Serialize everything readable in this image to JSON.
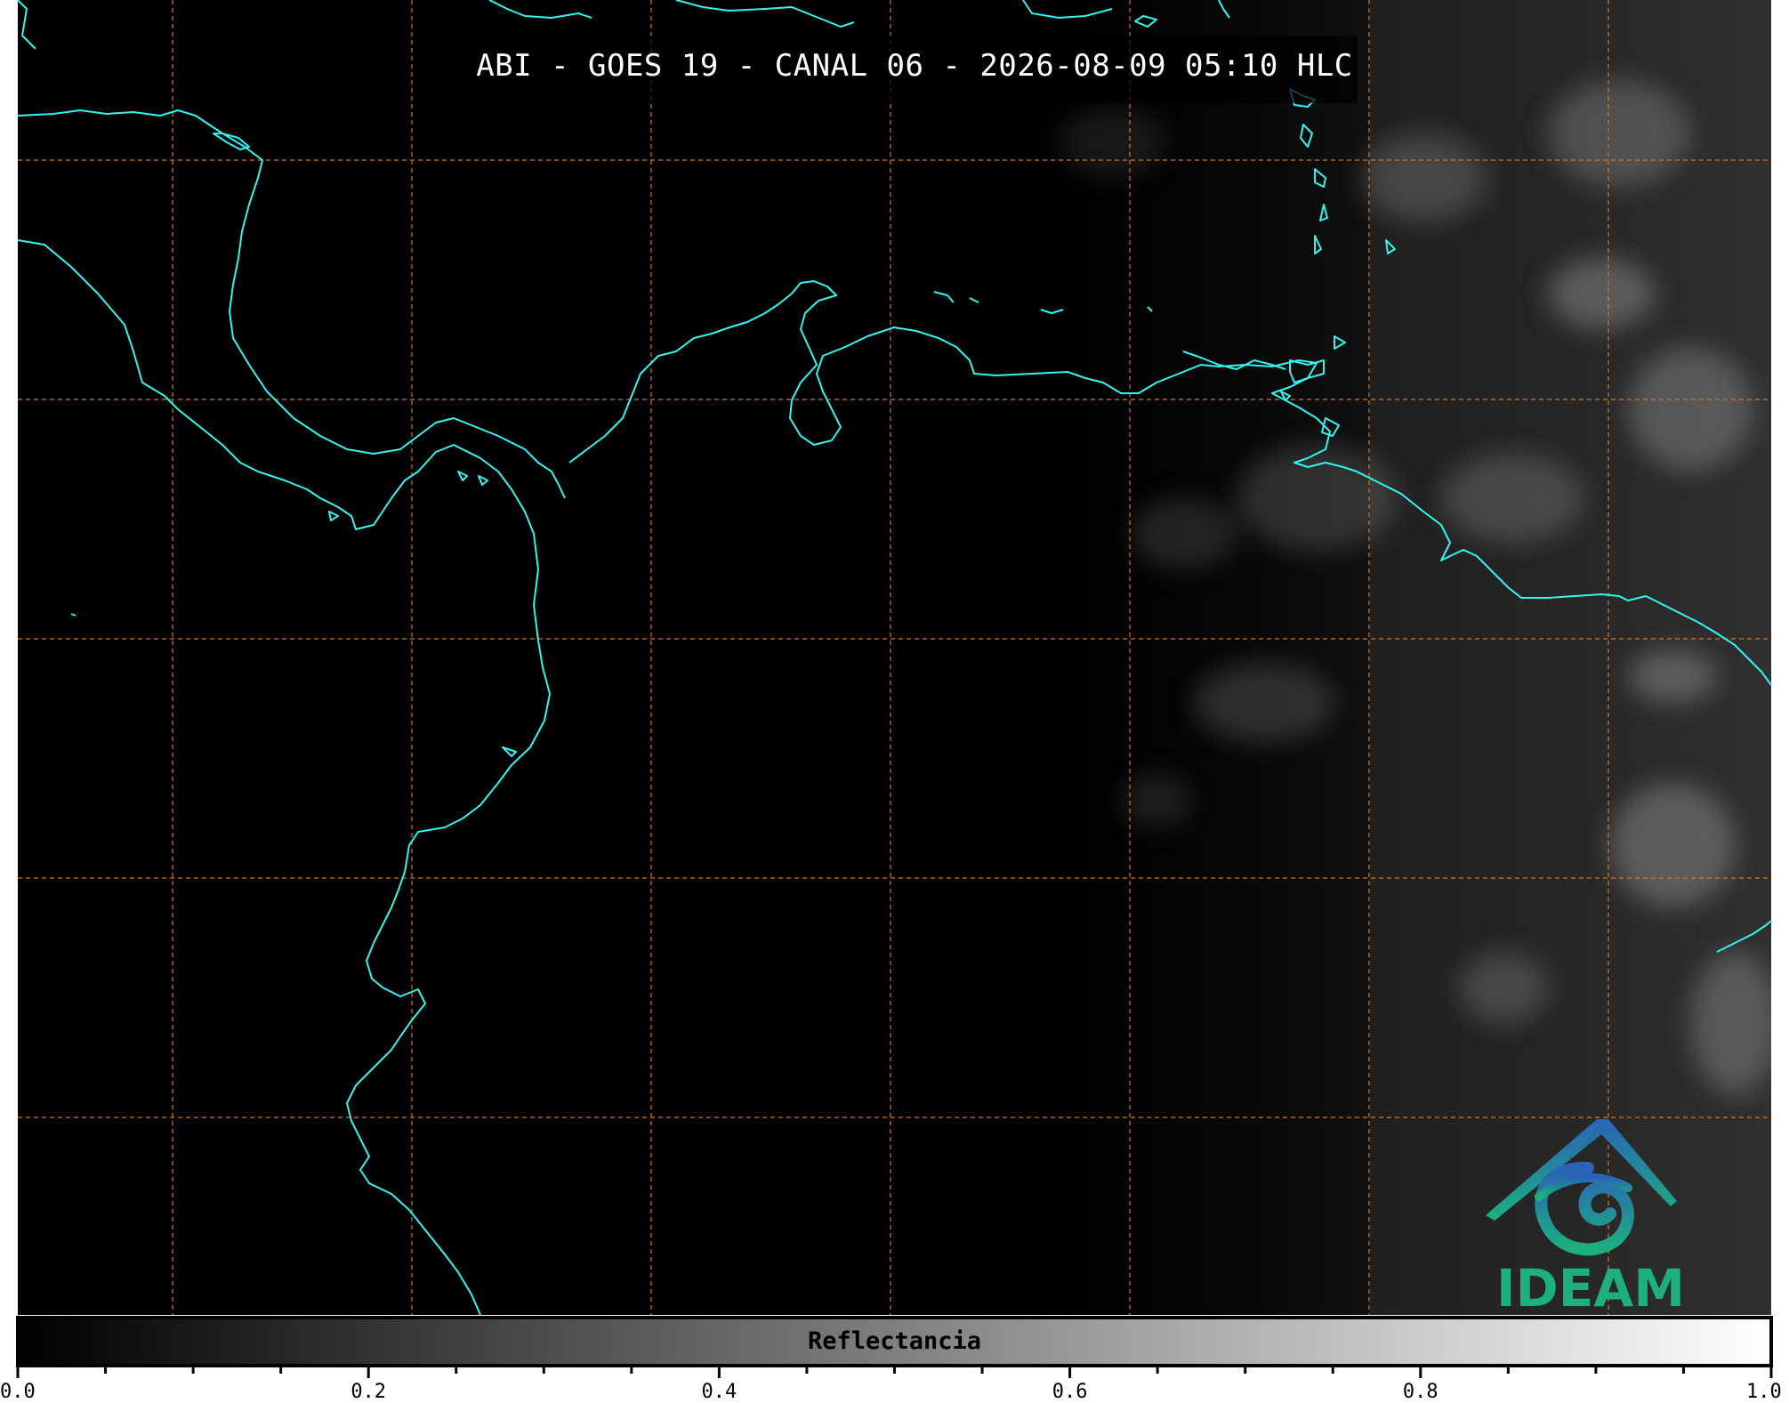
{
  "title": "ABI - GOES 19 - CANAL 06 - 2026-08-09 05:10 HLC",
  "logo": {
    "text": "IDEAM"
  },
  "colorbar": {
    "label": "Reflectancia",
    "range": [
      0.0,
      1.0
    ],
    "ticks": [
      "0.0",
      "0.2",
      "0.4",
      "0.6",
      "0.8",
      "1.0"
    ],
    "minor_ticks_per_interval": 4,
    "colors": {
      "min": "#000000",
      "max": "#ffffff"
    }
  },
  "map": {
    "background": "#000000",
    "coastline_color": "#33f5f0",
    "gridline_color": "#d2782a",
    "gridline_style": "dashed",
    "imagery": "grayscale satellite reflectance; clouds visible in east half"
  }
}
